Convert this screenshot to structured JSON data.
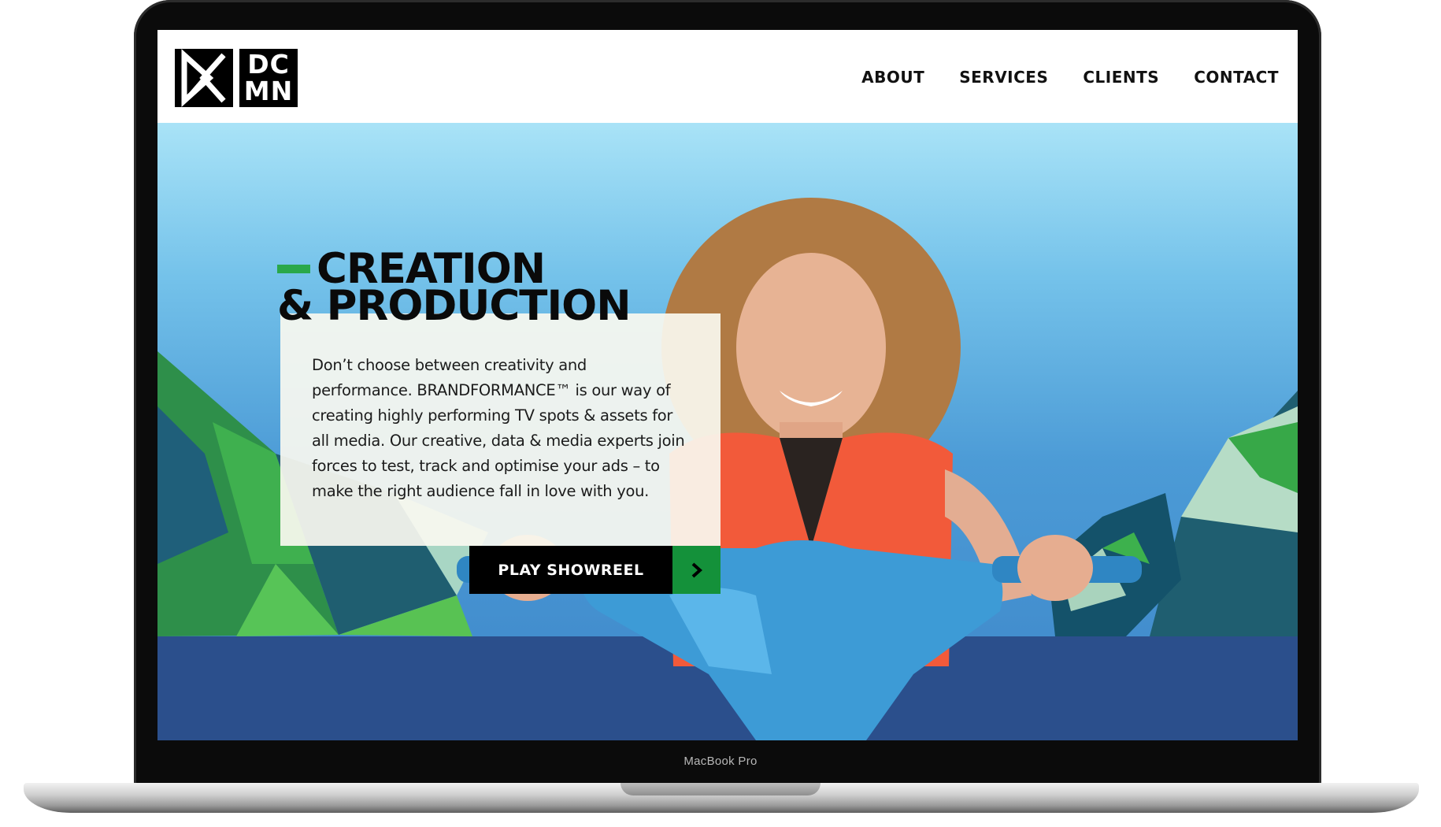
{
  "device": {
    "label": "MacBook Pro"
  },
  "header": {
    "logo_text_line1": "DC",
    "logo_text_line2": "MN",
    "nav": [
      {
        "label": "ABOUT"
      },
      {
        "label": "SERVICES"
      },
      {
        "label": "CLIENTS"
      },
      {
        "label": "CONTACT"
      }
    ]
  },
  "hero": {
    "title_line1": "CREATION",
    "title_line2": "& PRODUCTION",
    "body": "Don’t choose between creativity and performance. BRANDFORMANCE™ is our way of creating highly performing TV spots & assets for all media. Our creative, data & media experts join forces to test, track and optimise your ads – to make the right audience fall in love with you.",
    "cta_label": "PLAY SHOWREEL",
    "cta_icon": "chevron-right-icon",
    "accent_color": "#2aa84a",
    "cta_accent_color": "#14913a"
  }
}
